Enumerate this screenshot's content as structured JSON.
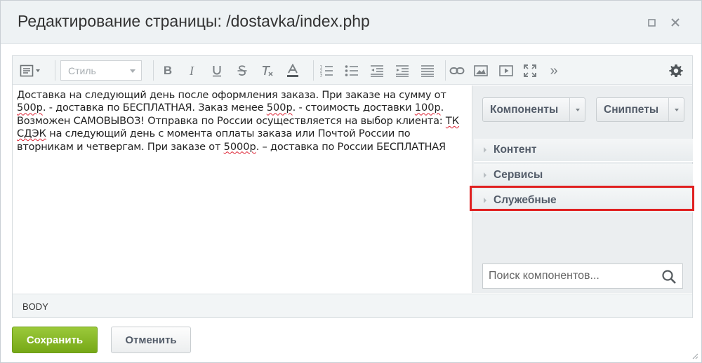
{
  "window": {
    "title": "Редактирование страницы: /dostavka/index.php",
    "maximize_icon": "square-icon",
    "close_icon": "close-icon"
  },
  "toolbar": {
    "style_placeholder": "Стиль",
    "buttons": [
      "mode",
      "bold",
      "italic",
      "underline",
      "strikethrough",
      "remove-format",
      "text-color",
      "ordered-list",
      "unordered-list",
      "outdent",
      "indent",
      "justify",
      "link",
      "image",
      "video",
      "fullscreen",
      "more",
      "settings"
    ],
    "bold_glyph": "B",
    "italic_glyph": "I",
    "more_glyph": "»"
  },
  "content": {
    "text_parts": [
      "Доставка  на следующий день после оформления заказа. При заказе на сумму от ",
      "500р",
      ". - доставка по БЕСПЛАТНАЯ. Заказ менее ",
      "500р",
      ". - стоимость доставки ",
      "100р",
      ". Возможен САМОВЫВОЗ! Отправка по России осуществляется на выбор клиента: ",
      "ТК",
      " ",
      "СДЭК",
      " на следующий день с момента оплаты заказа или Почтой России по вторникам и четвергам. При заказе от ",
      "5000р",
      ". – доставка по России БЕСПЛАТНАЯ"
    ]
  },
  "side": {
    "components_label": "Компоненты",
    "snippets_label": "Сниппеты",
    "sections": [
      "Контент",
      "Сервисы",
      "Служебные"
    ],
    "search_placeholder": "Поиск компонентов..."
  },
  "status": {
    "path": "BODY"
  },
  "footer": {
    "save_label": "Сохранить",
    "cancel_label": "Отменить"
  },
  "colors": {
    "save_bg": "#7fb21f",
    "highlight": "#e02020",
    "title_bar": "#eef2f4"
  }
}
